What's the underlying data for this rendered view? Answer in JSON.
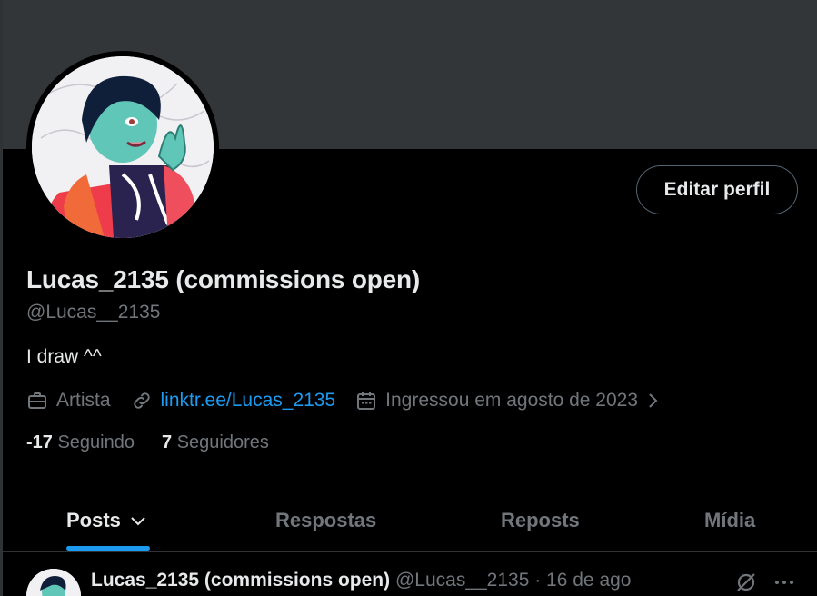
{
  "profile": {
    "display_name": "Lucas_2135 (commissions open)",
    "handle": "@Lucas__2135",
    "bio": "I draw ^^",
    "edit_label": "Editar perfil",
    "profession": "Artista",
    "link": "linktr.ee/Lucas_2135",
    "joined": "Ingressou em agosto de 2023",
    "following_count": "-17",
    "following_label": "Seguindo",
    "followers_count": "7",
    "followers_label": "Seguidores"
  },
  "tabs": [
    {
      "label": "Posts",
      "active": true
    },
    {
      "label": "Respostas",
      "active": false
    },
    {
      "label": "Reposts",
      "active": false
    },
    {
      "label": "Mídia",
      "active": false
    }
  ],
  "post": {
    "name": "Lucas_2135 (commissions open)",
    "meta": "@Lucas__2135 · 16 de ago"
  },
  "colors": {
    "accent": "#1d9bf0",
    "background": "#000000",
    "banner": "#333639",
    "muted": "#71767b"
  },
  "icons": [
    "briefcase-icon",
    "link-icon",
    "calendar-icon",
    "chevron-right-icon",
    "chevron-down-icon",
    "grok-icon",
    "more-icon"
  ]
}
